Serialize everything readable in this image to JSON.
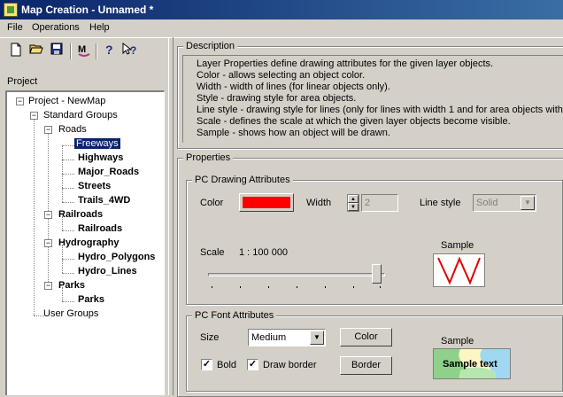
{
  "window": {
    "title": "Map Creation - Unnamed *"
  },
  "menu": [
    "File",
    "Operations",
    "Help"
  ],
  "toolbar": [
    "new-icon",
    "open-icon",
    "save-icon",
    "map-icon",
    "help-icon",
    "context-help-icon"
  ],
  "project": {
    "label": "Project",
    "tree": {
      "root": "Project - NewMap",
      "standard_groups": "Standard Groups",
      "roads": "Roads",
      "freeways": "Freeways",
      "highways": "Highways",
      "major_roads": "Major_Roads",
      "streets": "Streets",
      "trails": "Trails_4WD",
      "railroads_group": "Railroads",
      "railroads": "Railroads",
      "hydrography": "Hydrography",
      "hydro_polygons": "Hydro_Polygons",
      "hydro_lines": "Hydro_Lines",
      "parks_group": "Parks",
      "parks": "Parks",
      "user_groups": "User Groups"
    }
  },
  "description": {
    "title": "Description",
    "lines": [
      "Layer Properties define drawing attributes for the given layer objects.",
      "Color - allows selecting an object color.",
      "Width - width of lines (for linear objects only).",
      "Style - drawing style for area objects.",
      "Line style - drawing style for lines (only for lines with width 1 and for area objects with a bo",
      "Scale - defines the scale at which the given layer objects become visible.",
      "Sample - shows how an object will be drawn."
    ]
  },
  "properties": {
    "title": "Properties",
    "drawing": {
      "title": "PC Drawing Attributes",
      "color_label": "Color",
      "color_value": "#ff0000",
      "width_label": "Width",
      "width_value": "2",
      "line_style_label": "Line style",
      "line_style_value": "Solid",
      "scale_label": "Scale",
      "scale_value": "1 : 100 000",
      "scale_position": 0.95,
      "sample_label": "Sample"
    },
    "font": {
      "title": "PC Font Attributes",
      "size_label": "Size",
      "size_value": "Medium",
      "color_button": "Color",
      "bold_label": "Bold",
      "bold_checked": true,
      "draw_border_label": "Draw border",
      "draw_border_checked": true,
      "border_button": "Border",
      "sample_label": "Sample",
      "sample_text": "Sample text"
    }
  }
}
